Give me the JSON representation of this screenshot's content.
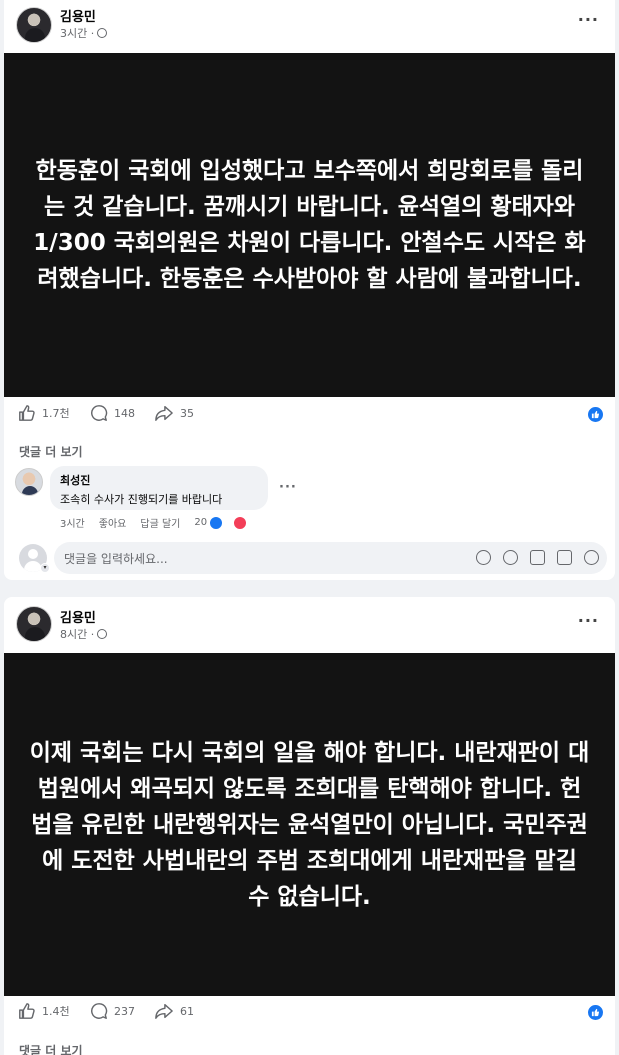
{
  "posts": [
    {
      "author": "김용민",
      "time": "3시간 · ",
      "image_text": "한동훈이 국회에 입성했다고 보수쪽에서 희망회로를 돌리는 것 같습니다. 꿈깨시기 바랍니다. 윤석열의 황태자와 1/300 국회의원은 차원이 다릅니다. 안철수도 시작은 화려했습니다. 한동훈은 수사받아야 할 사람에 불과합니다.",
      "likes": "1.7천",
      "comments": "148",
      "shares": "35",
      "more_comments": "댓글 더 보기",
      "comment": {
        "author": "최성진",
        "text": "조속히 수사가 진행되기를 바랍니다",
        "time": "3시간",
        "like_label": "좋아요",
        "reply_label": "답글 달기",
        "reaction_count": "20"
      },
      "input_placeholder": "댓글을 입력하세요..."
    },
    {
      "author": "김용민",
      "time": "8시간 · ",
      "image_text": "이제 국회는 다시 국회의 일을 해야 합니다. 내란재판이 대법원에서 왜곡되지 않도록 조희대를 탄핵해야 합니다. 헌법을 유린한 내란행위자는 윤석열만이 아닙니다. 국민주권에 도전한 사법내란의 주범 조희대에게 내란재판을 맡길 수 없습니다.",
      "likes": "1.4천",
      "comments": "237",
      "shares": "61",
      "more_comments": "댓글 더 보기"
    }
  ],
  "colors": {
    "accent": "#1877f2",
    "love": "#f33e58",
    "image_bg": "#131313"
  },
  "icons": [
    "more-icon",
    "globe-icon",
    "like-icon",
    "comment-icon",
    "share-icon",
    "emoji-icon",
    "camera-icon",
    "gif-icon",
    "sticker-icon"
  ]
}
